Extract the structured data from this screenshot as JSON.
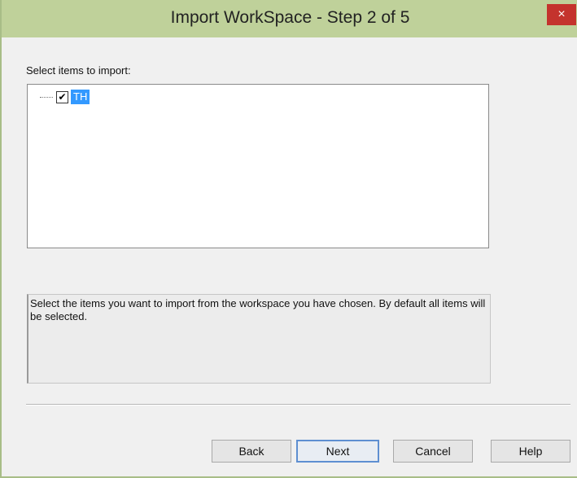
{
  "window": {
    "title": "Import WorkSpace - Step 2 of 5",
    "close_glyph": "×"
  },
  "select_label": "Select items to import:",
  "tree": {
    "items": [
      {
        "label": "TH",
        "checked": true,
        "check_glyph": "✔"
      }
    ]
  },
  "description": "Select the items you want to import from the workspace you have chosen. By default all items will be selected.",
  "buttons": {
    "back": "Back",
    "next": "Next",
    "cancel": "Cancel",
    "help": "Help"
  },
  "colors": {
    "titlebar": "#bfd19a",
    "close_button": "#c4332d",
    "selection": "#3399ff",
    "default_button_border": "#5e8fd1"
  }
}
